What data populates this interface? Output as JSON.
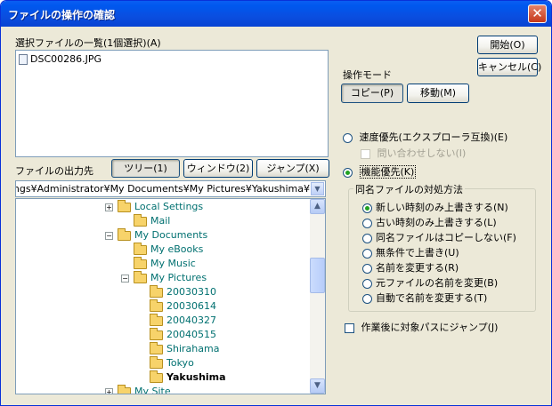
{
  "window": {
    "title": "ファイルの操作の確認",
    "close_glyph": "✕"
  },
  "file_list": {
    "label": "選択ファイルの一覧(1個選択)(A)",
    "items": [
      "DSC00286.JPG"
    ]
  },
  "buttons": {
    "start": "開始(O)",
    "cancel": "キャンセル(C)"
  },
  "operation_mode": {
    "label": "操作モード",
    "copy": "コピー(P)",
    "move": "移動(M)",
    "selected": "copy"
  },
  "output": {
    "label": "ファイルの出力先",
    "tabs": [
      "ツリー(1)",
      "ウィンドウ(2)",
      "ジャンプ(X)"
    ],
    "active_tab": 0,
    "path_value": "Settings¥Administrator¥My Documents¥My Pictures¥Yakushima¥",
    "dropdown_glyph": "▼"
  },
  "tree": {
    "scroll_up_glyph": "▲",
    "scroll_down_glyph": "▼",
    "items": [
      {
        "label": "Local Settings",
        "expander": "+"
      },
      {
        "label": "Mail",
        "expander": ""
      },
      {
        "label": "My Documents",
        "expander": "−"
      },
      {
        "label": "My eBooks",
        "expander": ""
      },
      {
        "label": "My Music",
        "expander": ""
      },
      {
        "label": "My Pictures",
        "expander": "−"
      },
      {
        "label": "20030310",
        "expander": ""
      },
      {
        "label": "20030614",
        "expander": ""
      },
      {
        "label": "20040327",
        "expander": ""
      },
      {
        "label": "20040515",
        "expander": ""
      },
      {
        "label": "Shirahama",
        "expander": ""
      },
      {
        "label": "Tokyo",
        "expander": ""
      },
      {
        "label": "Yakushima",
        "expander": "",
        "selected": true
      },
      {
        "label": "My Site",
        "expander": "+"
      }
    ]
  },
  "priority": {
    "speed": "速度優先(エクスプローラ互換)(E)",
    "no_ask": "問い合わせしない(I)",
    "feature": "機能優先(K)",
    "selected": "feature"
  },
  "same_name": {
    "label": "同名ファイルの対処方法",
    "options": [
      "新しい時刻のみ上書きする(N)",
      "古い時刻のみ上書きする(L)",
      "同名ファイルはコピーしない(F)",
      "無条件で上書き(U)",
      "名前を変更する(R)",
      "元ファイルの名前を変更(B)",
      "自動で名前を変更する(T)"
    ],
    "selected_index": 0
  },
  "jump_after": {
    "label": "作業後に対象パスにジャンプ(J)",
    "checked": false
  }
}
